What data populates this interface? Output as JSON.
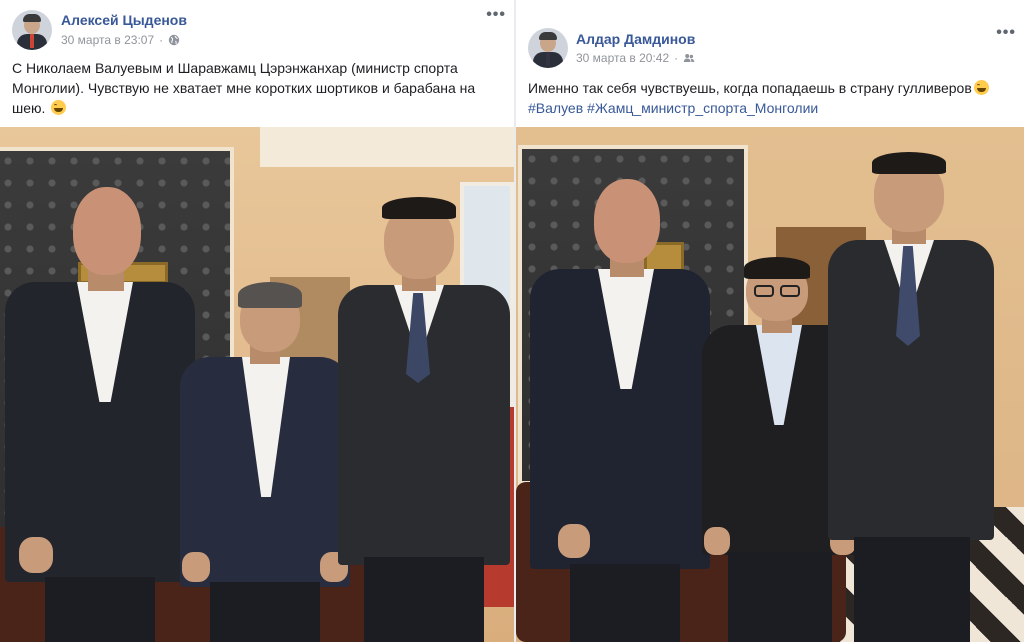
{
  "posts": [
    {
      "author": "Алексей Цыденов",
      "timestamp": "30 марта в 23:07",
      "separator": "·",
      "privacy": "globe-icon",
      "more": "•••",
      "text": "С Николаем Валуевым и Шаравжамц Цэрэнжанхар (министр спорта Монголии). Чувствую не хватает мне коротких шортиков и барабана на шею.",
      "emoji": "grinning-sweat-emoji"
    },
    {
      "author": "Алдар Дамдинов",
      "timestamp": "30 марта в 20:42",
      "separator": "·",
      "privacy": "friends-icon",
      "more": "•••",
      "text": "Именно так себя чувствуешь, когда попадаешь в страну гулливеров",
      "emoji": "laughing-emoji",
      "hashtags": [
        "#Валуев",
        "#Жамц_министр_спорта_Монголии"
      ]
    }
  ],
  "colors": {
    "link": "#385898",
    "meta": "#90949c",
    "text": "#1c1e21"
  }
}
